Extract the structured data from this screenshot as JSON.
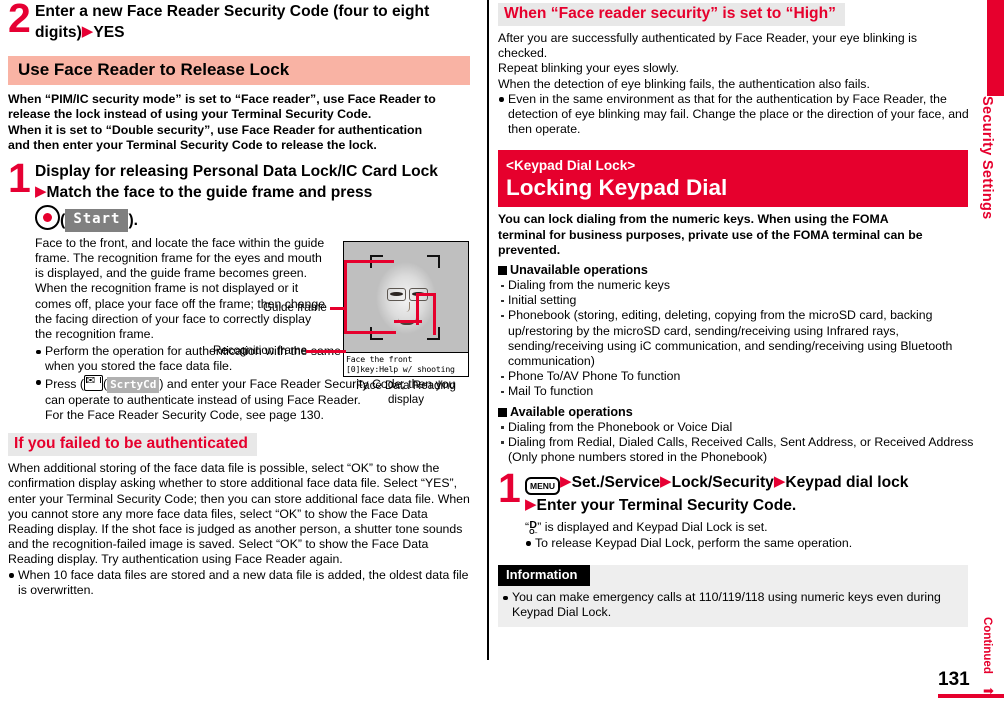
{
  "page": {
    "number": "131",
    "continued_label": "Continued",
    "side_tab_label": "Security Settings"
  },
  "left": {
    "step2": {
      "num": "2",
      "line1": "Enter a new Face Reader Security Code (four to eight",
      "line2_a": "digits)",
      "line2_b": "YES"
    },
    "section_title": "Use Face Reader to Release Lock",
    "intro": [
      "When “PIM/IC security mode” is set to “Face reader”, use Face Reader to",
      "release the lock instead of using your Terminal Security Code.",
      "When it is set to “Double security”, use Face Reader for authentication",
      "and then enter your Terminal Security Code to release the lock."
    ],
    "step1": {
      "num": "1",
      "line1": "Display for releasing Personal Data Lock/IC Card Lock",
      "line2": "Match the face to the guide frame and press",
      "key_start_label": "Start",
      "line3_tail": ")."
    },
    "step1_desc": "Face to the front, and locate the face within the guide frame. The recognition frame for the eyes and mouth is displayed, and the guide frame becomes green. When the recognition frame is not displayed or it comes off, place your face off the frame; then change the facing direction of your face to correctly display the recognition frame.",
    "step1_bullets": [
      "Perform the operation for authentication with the same facial expression as when you stored the face data file."
    ],
    "step1_bullet_press": {
      "pre": "Press (",
      "key_label": "ScrtyCd",
      "post": ") and enter your Face Reader Security Code; then you can operate to authenticate instead of using Face Reader.",
      "ref": "For the Face Reader Security Code, see page 130."
    },
    "figure": {
      "guide_frame_label": "Guide frame",
      "recognition_frame_label": "Recognition frame",
      "screen_line1": "Face the front",
      "screen_line2": "[0]key:Help w/ shooting",
      "caption_line1": "Face Data Reading",
      "caption_line2": "display"
    },
    "failed_title": "If you failed to be authenticated",
    "failed_body": "When additional storing of the face data file is possible, select “OK” to show the confirmation display asking whether to store additional face data file. Select “YES”, enter your Terminal Security Code; then you can store additional face data file. When you cannot store any more face data files, select “OK” to show the Face Data Reading display. If the shot face is judged as another person, a shutter tone sounds and the recognition-failed image is saved. Select “OK” to show the Face Data Reading display. Try authentication using Face Reader again.",
    "failed_bullets": [
      "When 10 face data files are stored and a new data file is added, the oldest data file is overwritten."
    ]
  },
  "right": {
    "high_title": "When “Face reader security” is set to “High”",
    "high_lines": [
      "After you are successfully authenticated by Face Reader, your eye blinking is checked.",
      "Repeat blinking your eyes slowly.",
      "When the detection of eye blinking fails, the authentication also fails."
    ],
    "high_bullets": [
      "Even in the same environment as that for the authentication by Face Reader, the detection of eye blinking may fail. Change the place or the direction of your face, and then operate."
    ],
    "chapter": {
      "tag": "<Keypad Dial Lock>",
      "title": "Locking Keypad Dial"
    },
    "chapter_intro": [
      "You can lock dialing from the numeric keys. When using the FOMA",
      "terminal for business purposes, private use of the FOMA terminal can be",
      "prevented."
    ],
    "unavailable_title": "Unavailable operations",
    "unavailable_items": [
      "Dialing from the numeric keys",
      "Initial setting",
      "Phonebook (storing, editing, deleting, copying from the microSD card, backing up/restoring by the microSD card, sending/receiving using Infrared rays, sending/receiving using iC communication, and sending/receiving using Bluetooth communication)",
      "Phone To/AV Phone To function",
      "Mail To function"
    ],
    "available_title": "Available operations",
    "available_items": [
      "Dialing from the Phonebook or Voice Dial",
      "Dialing from Redial, Dialed Calls, Received Calls, Sent Address, or Received Address (Only phone numbers stored in the Phonebook)"
    ],
    "step1": {
      "num": "1",
      "key_menu_label": "MENU",
      "seg1": "Set./Service",
      "seg2": "Lock/Security",
      "seg3": "Keypad dial lock",
      "line2": "Enter your Terminal Security Code."
    },
    "step1_notes": {
      "icon_text_pre": "“",
      "icon_d_top": "D",
      "icon_d_bottom": "O₋",
      "icon_text_post": "” is displayed and Keypad Dial Lock is set.",
      "bullet": "To release Keypad Dial Lock, perform the same operation."
    },
    "information": {
      "title": "Information",
      "bullets": [
        "You can make emergency calls at 110/119/118 using numeric keys even during Keypad Dial Lock."
      ]
    }
  },
  "colors": {
    "accent_red": "#e6002d",
    "pink_bar": "#f9b3a4",
    "gray_bar": "#e8e8e8",
    "info_bg": "#eeeeee"
  }
}
